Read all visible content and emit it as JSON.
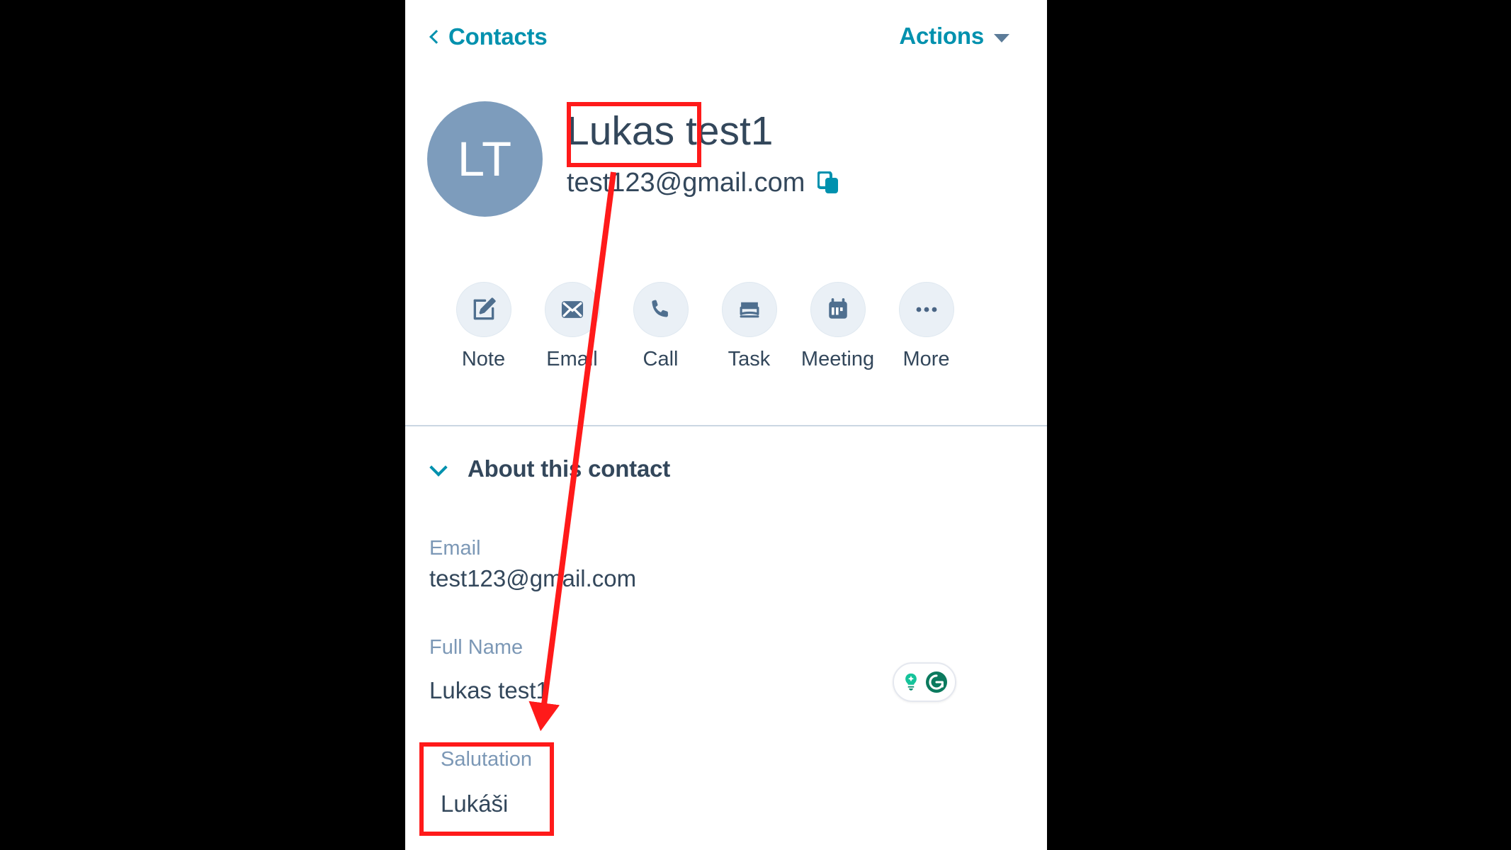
{
  "app": {
    "accent_teal": "#0091AE",
    "text_dark": "#33475B",
    "label_muted": "#7C98B6",
    "avatar_bg": "#7D9CBC",
    "circle_bg": "#EAF0F6",
    "annotation_red": "#FF1A1A",
    "divider": "#CBD6E2"
  },
  "topbar": {
    "back_label": "Contacts",
    "back_icon": "chevron-left-icon",
    "actions_label": "Actions",
    "actions_caret_icon": "caret-down-icon"
  },
  "identity": {
    "avatar_initials": "LT",
    "contact_name": "Lukas test1",
    "contact_name_first": "Lukas",
    "contact_name_last": "test1",
    "email": "test123@gmail.com",
    "copy_icon": "copy-icon"
  },
  "quick_actions": [
    {
      "label": "Note",
      "icon": "note-edit-icon"
    },
    {
      "label": "Email",
      "icon": "envelope-icon"
    },
    {
      "label": "Call",
      "icon": "phone-icon"
    },
    {
      "label": "Task",
      "icon": "task-book-icon"
    },
    {
      "label": "Meeting",
      "icon": "calendar-icon"
    },
    {
      "label": "More",
      "icon": "ellipsis-icon"
    }
  ],
  "about": {
    "title": "About this contact",
    "collapse_icon": "chevron-down-icon",
    "expanded": true
  },
  "fields": [
    {
      "label": "Email",
      "value": "test123@gmail.com"
    },
    {
      "label": "Full Name",
      "value": "Lukas test1"
    },
    {
      "label": "Salutation",
      "value": "Lukáši"
    }
  ],
  "grammarly": {
    "lightbulb_icon": "lightbulb-sparkle-icon",
    "logo_icon": "grammarly-g-icon",
    "green": "#15C39A",
    "dark_green": "#0B7A5E"
  },
  "annotations": {
    "highlight_name": "Lukas",
    "highlight_field": "Salutation",
    "arrow_from": "contact-name-first",
    "arrow_to": "salutation-field"
  }
}
